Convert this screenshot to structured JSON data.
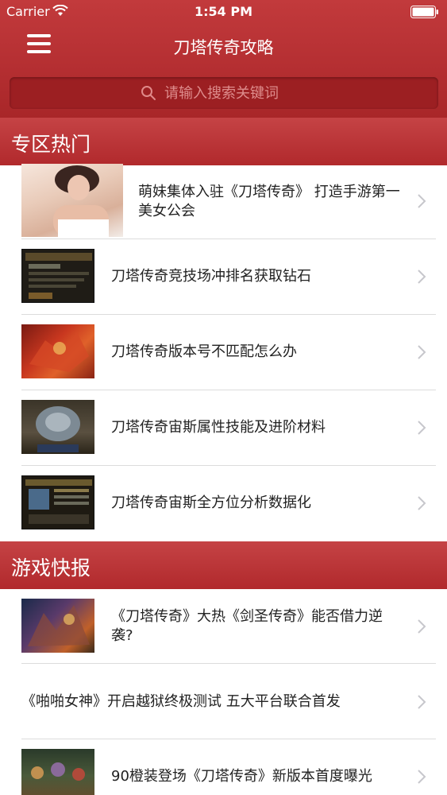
{
  "status_bar": {
    "carrier": "Carrier",
    "time": "1:54 PM"
  },
  "nav": {
    "title": "刀塔传奇攻略"
  },
  "search": {
    "placeholder": "请输入搜索关键词"
  },
  "sections": [
    {
      "title": "专区热门",
      "items": [
        {
          "title": "萌妹集体入驻《刀塔传奇》 打造手游第一美女公会",
          "thumbnail": "photo-girl"
        },
        {
          "title": "刀塔传奇竞技场冲排名获取钻石",
          "thumbnail": "screenshot-dark"
        },
        {
          "title": "刀塔传奇版本号不匹配怎么办",
          "thumbnail": "hero-red-dragon"
        },
        {
          "title": "刀塔传奇宙斯属性技能及进阶材料",
          "thumbnail": "hero-armored"
        },
        {
          "title": "刀塔传奇宙斯全方位分析数据化",
          "thumbnail": "screenshot-panel"
        }
      ]
    },
    {
      "title": "游戏快报",
      "items": [
        {
          "title": "《刀塔传奇》大热《剑圣传奇》能否借力逆袭?",
          "thumbnail": "game-scene"
        },
        {
          "title": "《啪啪女神》开启越狱终极测试 五大平台联合首发",
          "thumbnail": ""
        },
        {
          "title": "90橙装登场《刀塔传奇》新版本首度曝光",
          "thumbnail": "battle-scene"
        }
      ]
    }
  ],
  "colors": {
    "header_red": "#b52f32",
    "section_red": "#b1292c",
    "text": "#222222",
    "separator": "#dcdcdc"
  }
}
